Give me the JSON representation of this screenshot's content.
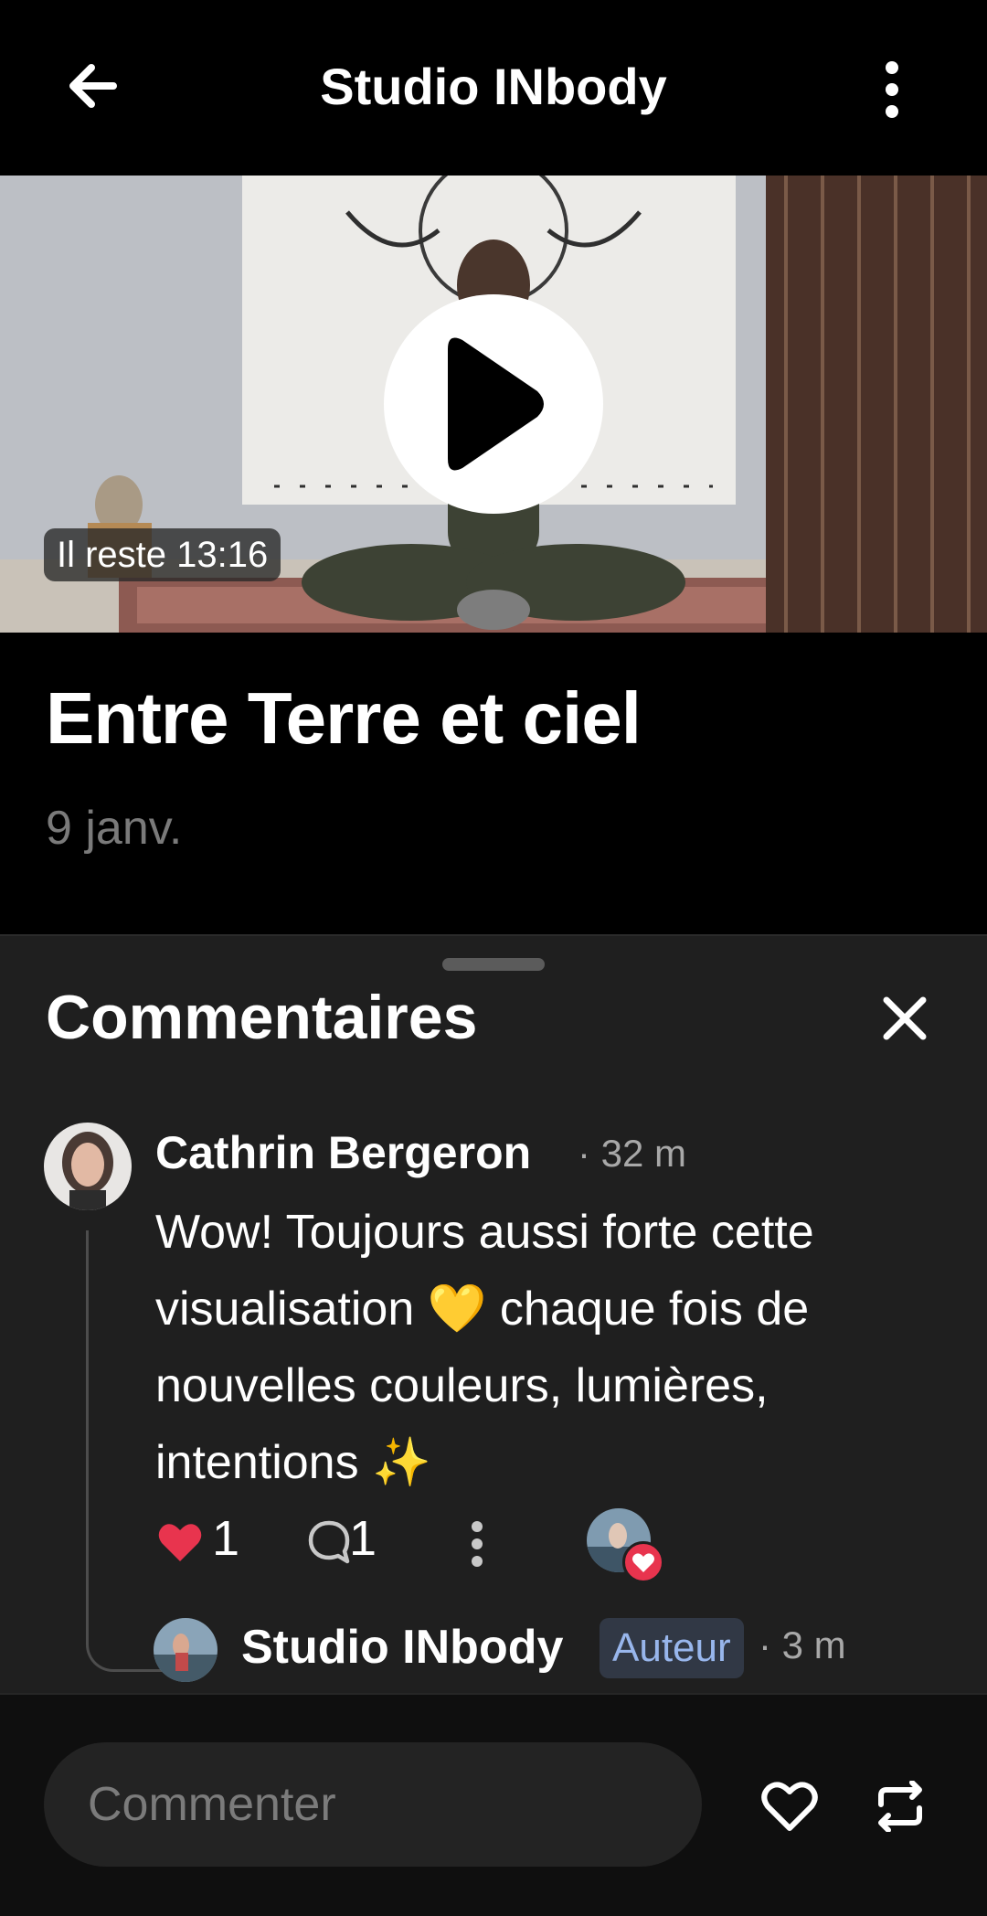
{
  "header": {
    "title": "Studio INbody"
  },
  "video": {
    "time_remaining": "Il reste 13:16"
  },
  "post": {
    "title": "Entre Terre et ciel",
    "date": "9 janv."
  },
  "comments_sheet": {
    "title": "Commentaires",
    "comment": {
      "author": "Cathrin Bergeron",
      "time": "· 32 m",
      "text": "Wow! Toujours aussi forte cette visualisation 💛 chaque fois de nouvelles couleurs, lumières, intentions ✨",
      "like_count": "1",
      "reply_count": "1"
    },
    "reply": {
      "author": "Studio INbody",
      "badge": "Auteur",
      "time": "· 3 m"
    }
  },
  "composer": {
    "placeholder": "Commenter"
  },
  "colors": {
    "like_red": "#e8344e",
    "badge_blue": "#98b6ec",
    "sheet_bg": "#1f1f1f"
  }
}
